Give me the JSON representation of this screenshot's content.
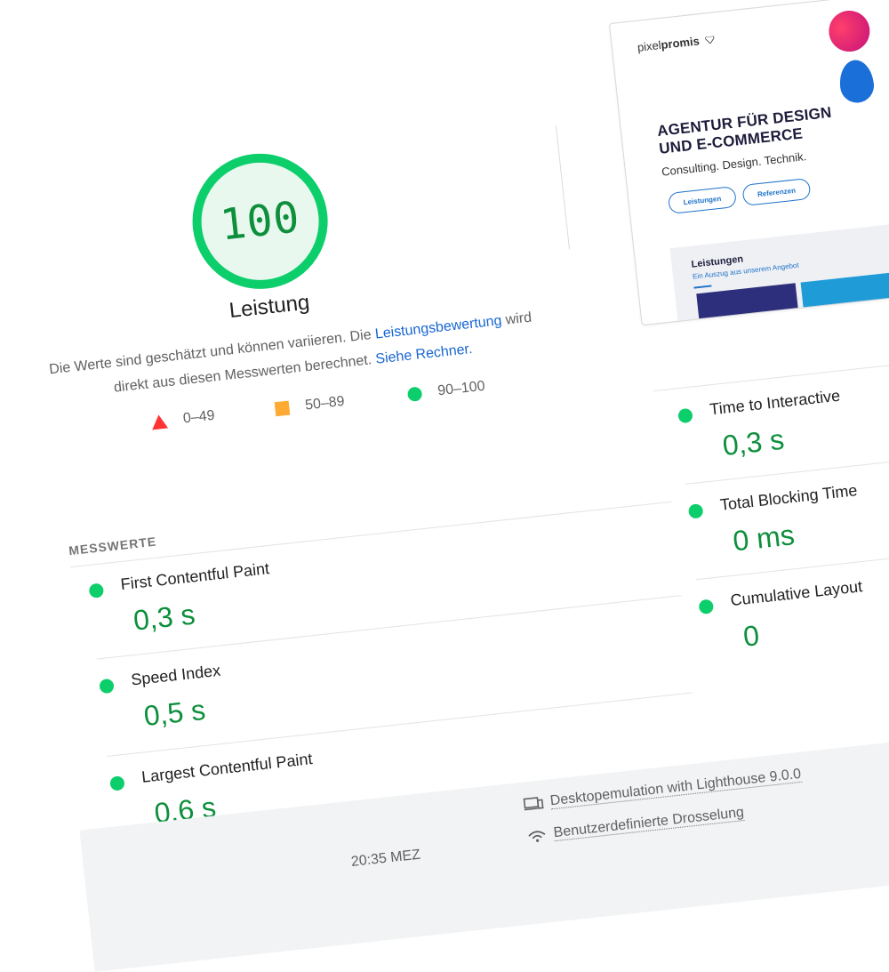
{
  "score": {
    "value": "100",
    "title": "Leistung"
  },
  "description": {
    "part1": "Die Werte sind geschätzt und können variieren. Die ",
    "link1": "Leistungsbewertung",
    "part2": " wird direkt aus diesen Messwerten berechnet. ",
    "link2": "Siehe Rechner."
  },
  "legend": [
    {
      "shape": "triangle",
      "range": "0–49",
      "color": "#ff3333"
    },
    {
      "shape": "square",
      "range": "50–89",
      "color": "#ffaa33"
    },
    {
      "shape": "circle",
      "range": "90–100",
      "color": "#0cce6b"
    }
  ],
  "thumbnail": {
    "logo_light": "pixel",
    "logo_bold": "promis",
    "headline_line1": "AGENTUR FÜR DESIGN",
    "headline_line2": "UND E-COMMERCE",
    "subline": "Consulting. Design. Technik.",
    "button1": "Leistungen",
    "button2": "Referenzen",
    "section_title": "Leistungen",
    "section_sub": "Ein Auszug aus unserem Angebot"
  },
  "metrics_section_title": "MESSWERTE",
  "metrics": [
    {
      "name": "First Contentful Paint",
      "value": "0,3 s"
    },
    {
      "name": "Speed Index",
      "value": "0,5 s"
    },
    {
      "name": "Largest Contentful Paint",
      "value": "0,6 s"
    },
    {
      "name": "Time to Interactive",
      "value": "0,3 s"
    },
    {
      "name": "Total Blocking Time",
      "value": "0 ms"
    },
    {
      "name": "Cumulative Layout",
      "value": "0"
    }
  ],
  "footer": {
    "emulation": "Desktopemulation with Lighthouse 9.0.0",
    "throttling": "Benutzerdefinierte Drosselung",
    "timestamp": "20:35 MEZ"
  },
  "colors": {
    "pass": "#0cce6b",
    "pass_text": "#0d8f3c",
    "link": "#1967d2"
  }
}
